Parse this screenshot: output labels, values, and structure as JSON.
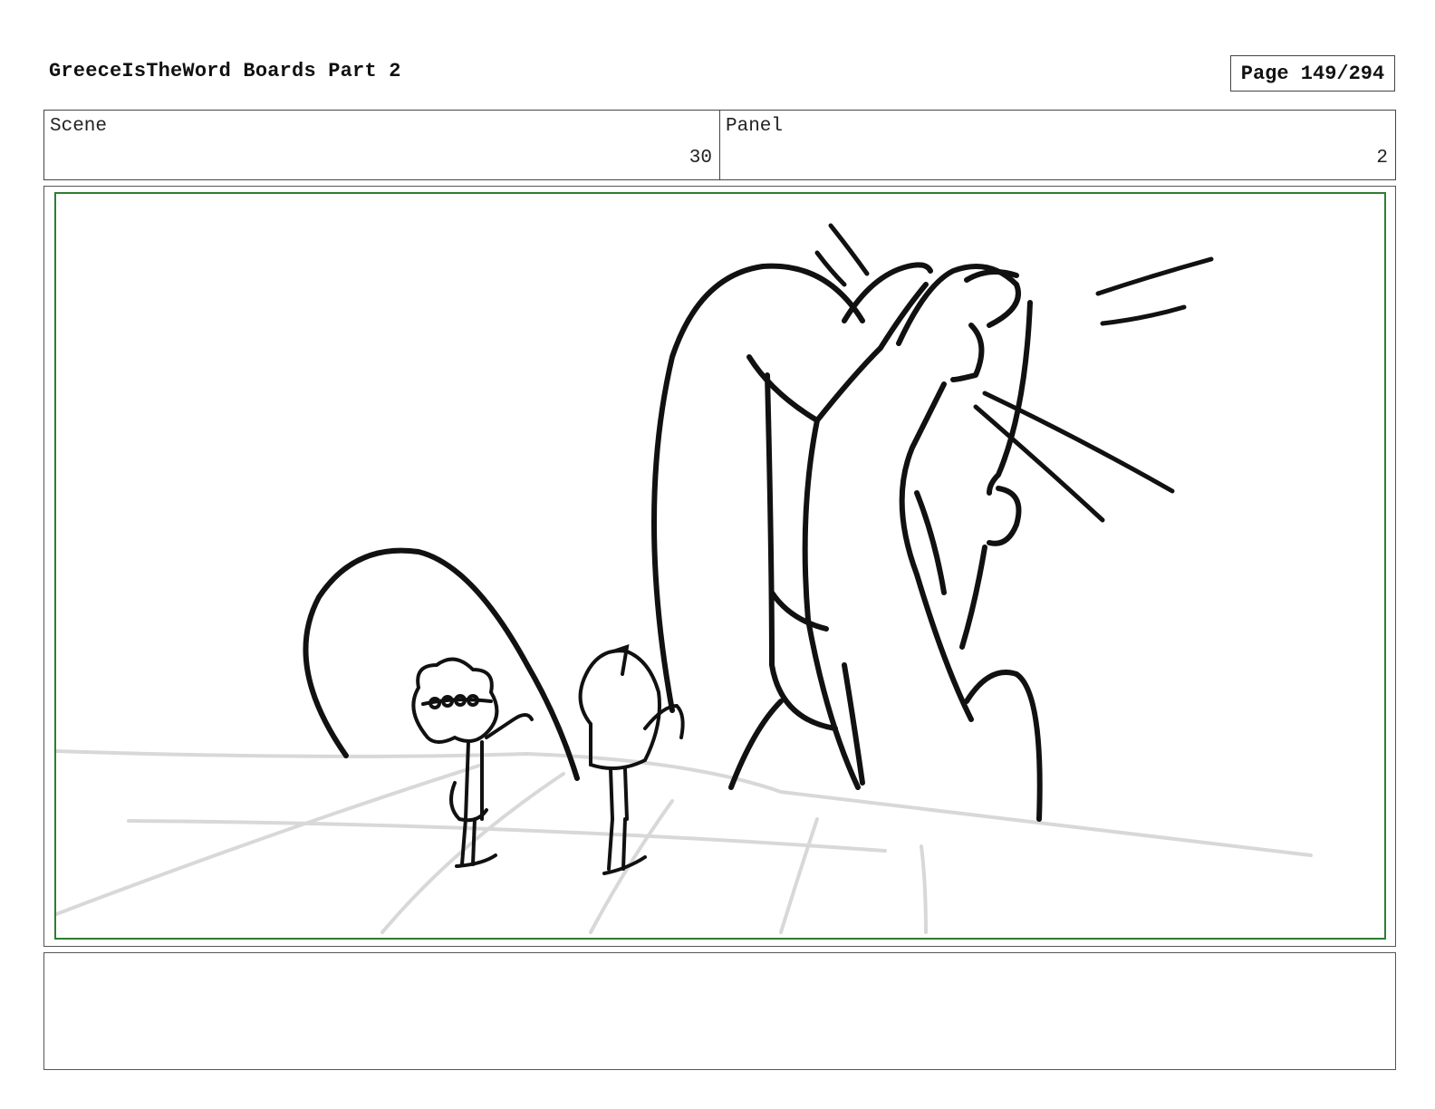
{
  "header": {
    "title": "GreeceIsTheWord Boards Part 2",
    "page_label": "Page 149/294"
  },
  "info": {
    "scene_label": "Scene",
    "scene_value": "30",
    "panel_label": "Panel",
    "panel_value": "2"
  },
  "notes": {
    "text": ""
  },
  "colors": {
    "frame_border": "#2e7d32",
    "ink": "#111111",
    "floor_lines": "#d8d8d8"
  }
}
